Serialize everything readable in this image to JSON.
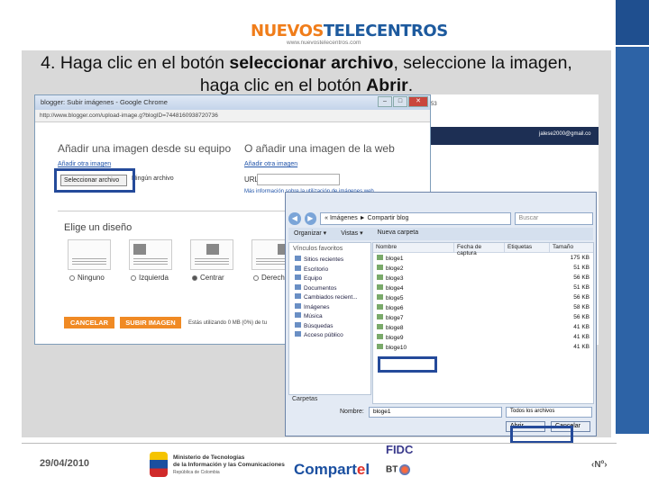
{
  "header": {
    "logo_part1": "NUEVOS",
    "logo_part2": "TELECENTROS",
    "logo_url": "www.nuevostelecentros.com"
  },
  "instruction": {
    "prefix": "4.  Haga clic en el botón ",
    "bold1": "seleccionar archivo",
    "middle": ", seleccione la imagen, haga clic en el botón ",
    "bold2": "Abrir",
    "suffix": "."
  },
  "chrome": {
    "title": "blogger: Subir imágenes - Google Chrome",
    "url": "http://www.blogger.com/upload-image.g?blogID=7448160938720736",
    "heading_local": "Añadir una imagen desde su equipo",
    "heading_web": "O añadir una imagen de la web",
    "add_other_local": "Añadir otra imagen",
    "add_other_web": "Añadir otra imagen",
    "select_button": "Seleccionar archivo",
    "file_hint": "Ningún archivo",
    "url_label": "URL",
    "web_info": "Más información sobre la utilización de imágenes web",
    "layout_heading": "Elige un diseño",
    "layout_options": [
      "Ninguno",
      "Izquierda",
      "Centrar",
      "Derecha"
    ],
    "cancel_button": "CANCELAR",
    "upload_button": "SUBIR IMAGEN",
    "usage": "Estás utilizando 0 MB (0%) de tu"
  },
  "blog_bg": {
    "email": "jalese2000@gmail.co",
    "num": "53"
  },
  "dialog": {
    "path": "« Imágenes ► Compartir blog",
    "search_placeholder": "Buscar",
    "toolbar": [
      "Organizar ▾",
      "Vistas ▾",
      "Nueva carpeta"
    ],
    "favorites_heading": "Vínculos favoritos",
    "nav_items": [
      "Sitios recientes",
      "Escritorio",
      "Equipo",
      "Documentos",
      "Cambiados recient...",
      "Imágenes",
      "Música",
      "Búsquedas",
      "Acceso público"
    ],
    "folders_label": "Carpetas",
    "columns": [
      "Nombre",
      "Fecha de captura",
      "Etiquetas",
      "Tamaño"
    ],
    "files": [
      {
        "name": "bloge1",
        "size": "175 KB"
      },
      {
        "name": "bloge2",
        "size": "51 KB"
      },
      {
        "name": "bloge3",
        "size": "56 KB"
      },
      {
        "name": "bloge4",
        "size": "51 KB"
      },
      {
        "name": "bloge5",
        "size": "56 KB"
      },
      {
        "name": "bloge6",
        "size": "58 KB"
      },
      {
        "name": "bloge7",
        "size": "56 KB"
      },
      {
        "name": "bloge8",
        "size": "41 KB"
      },
      {
        "name": "bloge9",
        "size": "41 KB"
      },
      {
        "name": "bloge10",
        "size": "41 KB"
      }
    ],
    "filename_label": "Nombre:",
    "filename_value": "bloge1",
    "file_type": "Todos los archivos",
    "open_button": "Abrir",
    "cancel_button": "Cancelar"
  },
  "footer": {
    "date": "29/04/2010",
    "ministry_line1": "Ministerio de Tecnologías",
    "ministry_line2": "de la Información y las Comunicaciones",
    "ministry_sub": "República de Colombia",
    "compartel_a": "Compart",
    "compartel_b": "e",
    "compartel_c": "l",
    "fidc": "FIDC",
    "bt": "BT",
    "page_num": "‹Nº›"
  }
}
